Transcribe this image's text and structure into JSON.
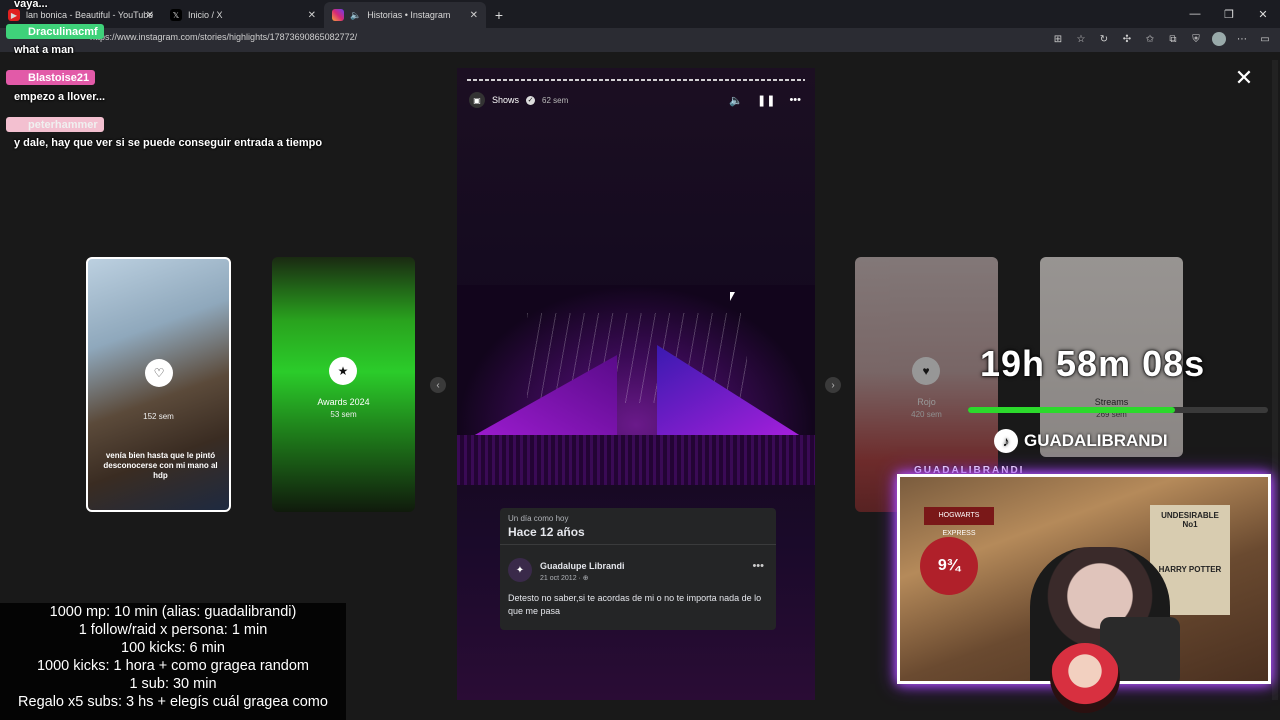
{
  "tabs": [
    {
      "label": "lan bonica - Beautiful - YouTube",
      "icon": "youtube-icon",
      "active": false
    },
    {
      "label": "Inicio / X",
      "icon": "x-icon",
      "active": false
    },
    {
      "label": "Historias • Instagram",
      "icon": "instagram-icon",
      "active": true
    }
  ],
  "address": {
    "url": "https://www.instagram.com/stories/highlights/17873690865082772/"
  },
  "story": {
    "account": "Shows",
    "time": "62 sem",
    "memory": {
      "subtitle": "Un día como hoy",
      "title": "Hace 12 años",
      "author": "Guadalupe Librandi",
      "date": "21 oct 2012 · ⊕",
      "text": "Detesto no saber,si te acordas de mi o no te importa nada de lo que me pasa"
    }
  },
  "side_cards": [
    {
      "label": "",
      "time": "152 sem",
      "text": "venía bien hasta que le pintó desconocerse con mi mano al hdp"
    },
    {
      "label": "Awards 2024",
      "time": "53 sem"
    },
    {
      "label": "Rojo",
      "time": "420 sem"
    },
    {
      "label": "Streams",
      "time": "269 sem"
    }
  ],
  "chat": [
    {
      "user": "",
      "text": "vaya..."
    },
    {
      "user": "Draculinacmf",
      "text": "what a man"
    },
    {
      "user": "Blastoise21",
      "text": "empezo a llover..."
    },
    {
      "user": "peterhammer",
      "text": "y dale, hay que ver si se puede conseguir entrada a tiempo"
    }
  ],
  "stream": {
    "timer": "19h 58m 08s",
    "timer_progress": 0.69,
    "tiktok": "GUADALIBRANDI",
    "cam_label": "GUADALIBRANDI"
  },
  "rules": [
    "1000 mp: 10 min (alias: guadalibrandi)",
    "1 follow/raid x persona: 1 min",
    "100 kicks: 6 min",
    "1000 kicks: 1 hora + como grageа random",
    "1 sub: 30 min",
    "Regalo x5 subs: 3 hs + elegís cuál gragea como"
  ],
  "colors": {
    "accent_green": "#2cd92c",
    "glow": "#b65bff",
    "badge_green": "#3fd27a",
    "badge_pink": "#e25aa8"
  }
}
